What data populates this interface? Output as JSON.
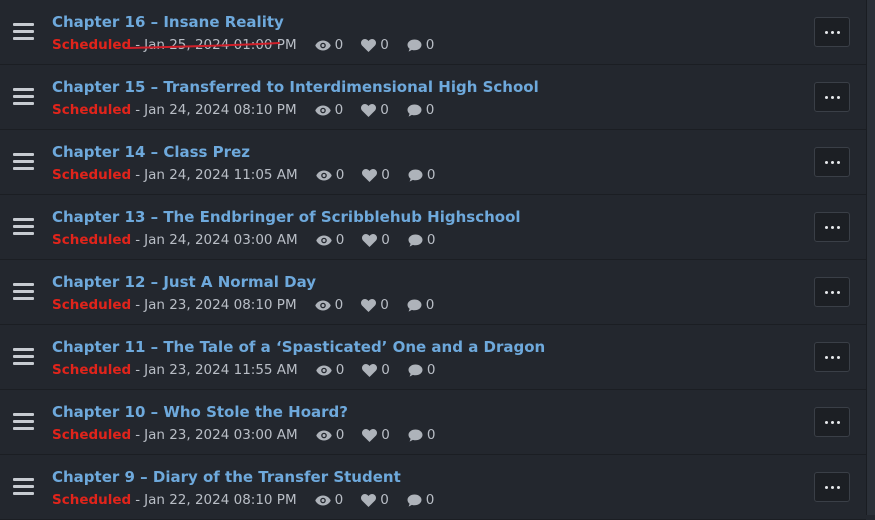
{
  "chapters": [
    {
      "title": "Chapter 16 – Insane Reality",
      "status": "Scheduled",
      "date": "Jan 25, 2024 01:00 PM",
      "views": "0",
      "likes": "0",
      "comments": "0"
    },
    {
      "title": "Chapter 15 – Transferred to Interdimensional High School",
      "status": "Scheduled",
      "date": "Jan 24, 2024 08:10 PM",
      "views": "0",
      "likes": "0",
      "comments": "0"
    },
    {
      "title": "Chapter 14 – Class Prez",
      "status": "Scheduled",
      "date": "Jan 24, 2024 11:05 AM",
      "views": "0",
      "likes": "0",
      "comments": "0"
    },
    {
      "title": "Chapter 13 – The Endbringer of Scribblehub Highschool",
      "status": "Scheduled",
      "date": "Jan 24, 2024 03:00 AM",
      "views": "0",
      "likes": "0",
      "comments": "0"
    },
    {
      "title": "Chapter 12 – Just A Normal Day",
      "status": "Scheduled",
      "date": "Jan 23, 2024 08:10 PM",
      "views": "0",
      "likes": "0",
      "comments": "0"
    },
    {
      "title": "Chapter 11 – The Tale of a ‘Spasticated’ One and a Dragon",
      "status": "Scheduled",
      "date": "Jan 23, 2024 11:55 AM",
      "views": "0",
      "likes": "0",
      "comments": "0"
    },
    {
      "title": "Chapter 10 – Who Stole the Hoard?",
      "status": "Scheduled",
      "date": "Jan 23, 2024 03:00 AM",
      "views": "0",
      "likes": "0",
      "comments": "0"
    },
    {
      "title": "Chapter 9 – Diary of the Transfer Student",
      "status": "Scheduled",
      "date": "Jan 22, 2024 08:10 PM",
      "views": "0",
      "likes": "0",
      "comments": "0"
    }
  ],
  "separator": "-",
  "icons": {
    "drag": "drag-handle-icon",
    "views": "eye-icon",
    "likes": "heart-icon",
    "comments": "comment-icon",
    "more": "ellipsis-icon"
  },
  "colors": {
    "background": "#23272e",
    "title": "#6ea9dc",
    "status": "#e0241b",
    "meta": "#b9bec6",
    "annotation": "#d0202a"
  },
  "annotation": "red hand-drawn underline beneath the first chapter's scheduled date"
}
